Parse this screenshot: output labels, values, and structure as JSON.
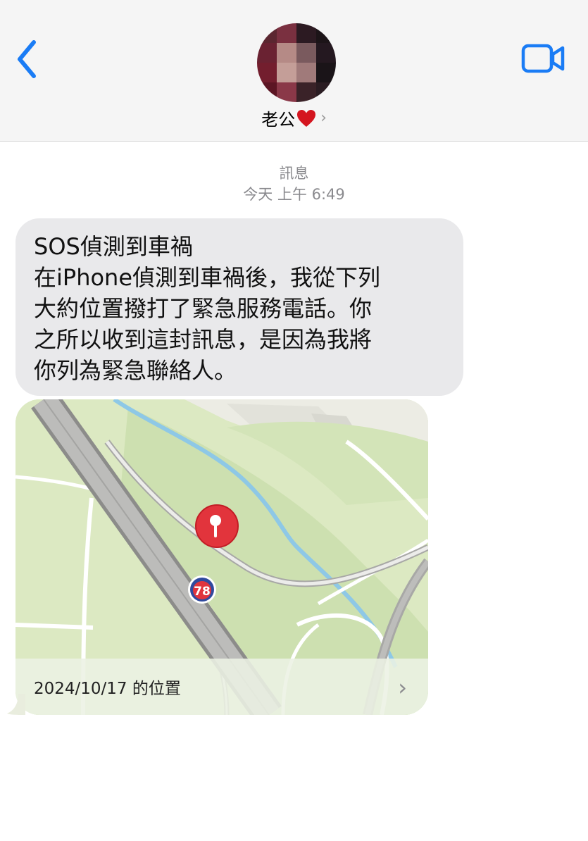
{
  "header": {
    "contact_name": "老公",
    "contact_emoji_icon": "red-heart-icon",
    "back_icon": "chevron-left-icon",
    "video_icon": "video-camera-icon",
    "accent_color": "#1a7cf5"
  },
  "conversation": {
    "service_label": "訊息",
    "timestamp": "今天 上午 6:49"
  },
  "message": {
    "lines": [
      "SOS偵測到車禍",
      "在iPhone偵測到車禍後，我從下列",
      "大約位置撥打了緊急服務電話。你",
      "之所以收到這封訊息，是因為我將",
      "你列為緊急聯絡人。"
    ]
  },
  "location_card": {
    "route_shield": "78",
    "caption": "2024/10/17 的位置",
    "pin_icon": "map-pin-icon",
    "arrow_icon": "chevron-right-icon"
  }
}
